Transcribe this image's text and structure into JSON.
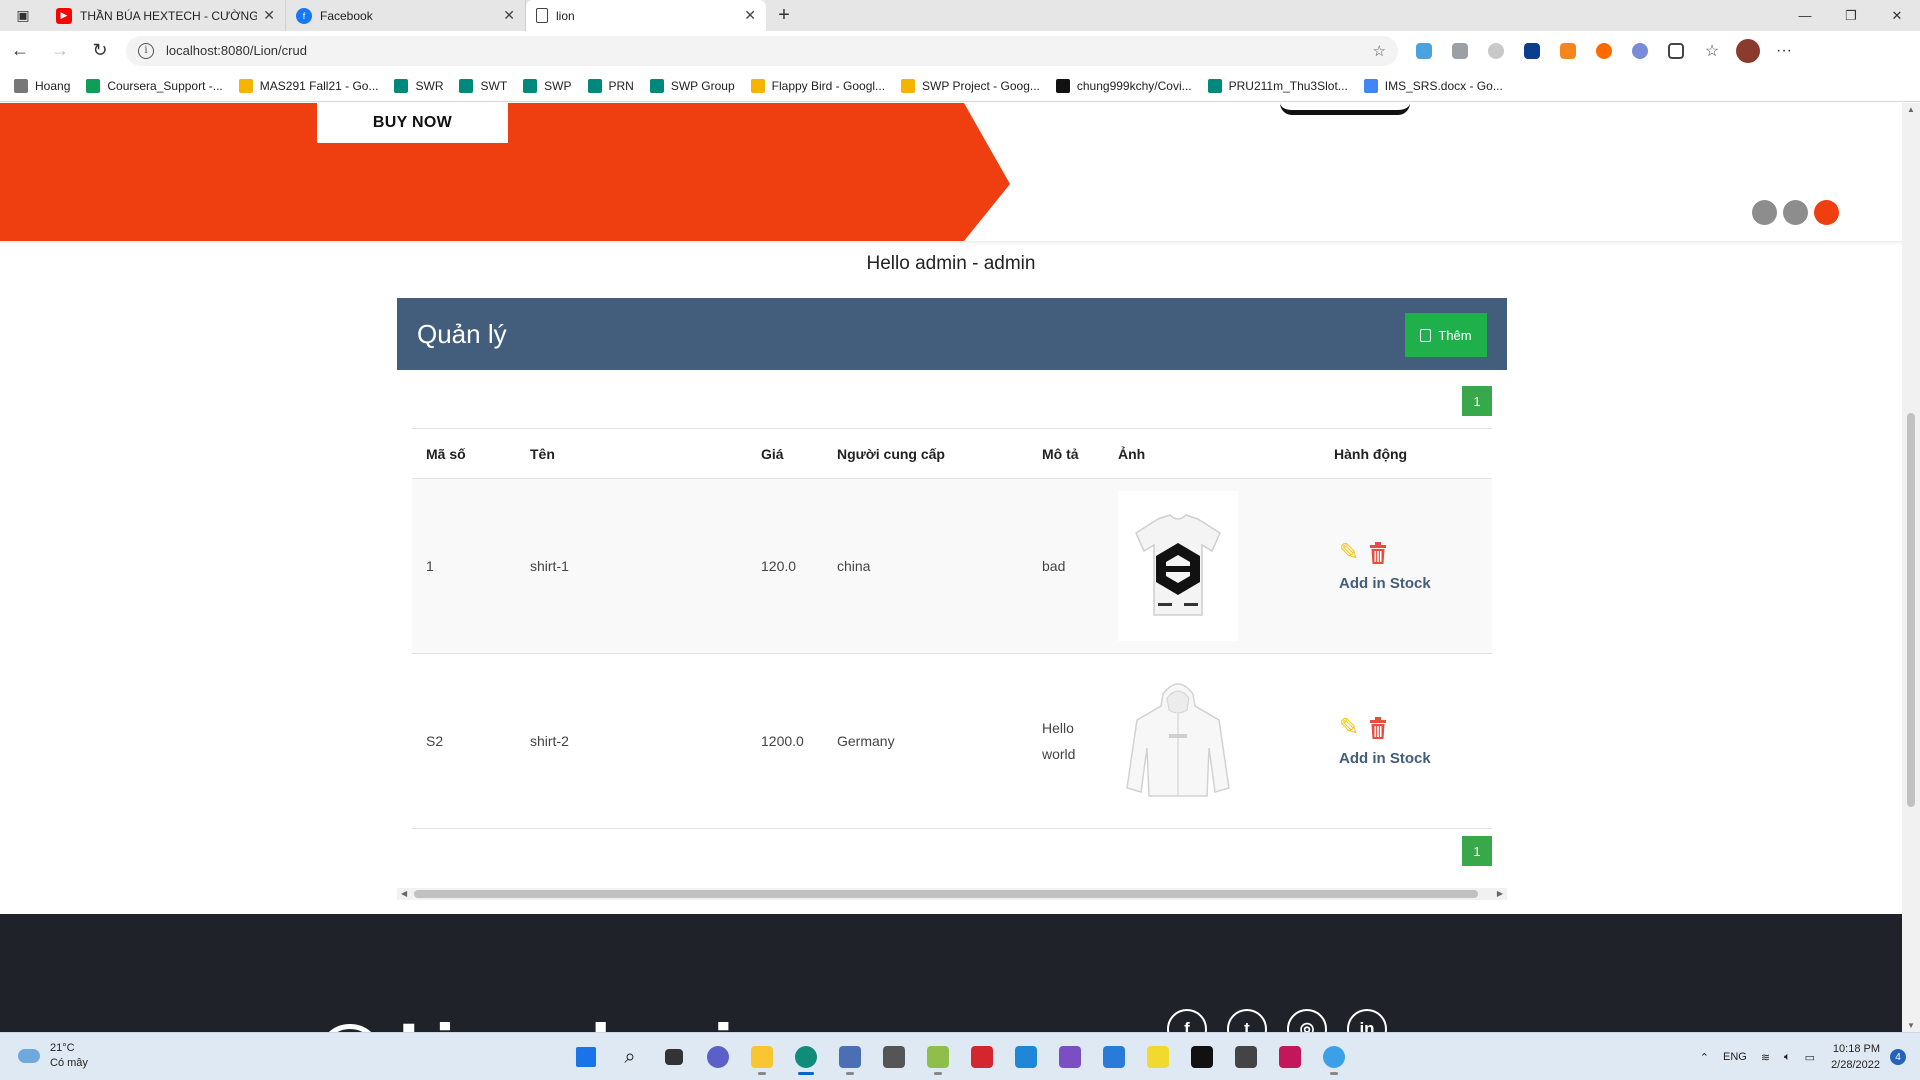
{
  "browser": {
    "tabs": [
      {
        "title": "THẦN BÚA HEXTECH - CƯỜNG",
        "favicon": "youtube-icon",
        "color": "#ff0000"
      },
      {
        "title": "Facebook",
        "favicon": "facebook-icon",
        "color": "#1877f2"
      },
      {
        "title": "lion",
        "favicon": "page-icon",
        "color": "#ffffff"
      }
    ],
    "url": "localhost:8080/Lion/crud",
    "bookmarks": [
      {
        "label": "Hoang",
        "color": "#777777"
      },
      {
        "label": "Coursera_Support -...",
        "color": "#0f9d58"
      },
      {
        "label": "MAS291 Fall21 - Go...",
        "color": "#f4b400"
      },
      {
        "label": "SWR",
        "color": "#00897b"
      },
      {
        "label": "SWT",
        "color": "#00897b"
      },
      {
        "label": "SWP",
        "color": "#00897b"
      },
      {
        "label": "PRN",
        "color": "#00897b"
      },
      {
        "label": "SWP Group",
        "color": "#00897b"
      },
      {
        "label": "Flappy Bird - Googl...",
        "color": "#f4b400"
      },
      {
        "label": "SWP Project - Goog...",
        "color": "#f4b400"
      },
      {
        "label": "chung999kchy/Covi...",
        "color": "#111111"
      },
      {
        "label": "PRU211m_Thu3Slot...",
        "color": "#00897b"
      },
      {
        "label": "IMS_SRS.docx - Go...",
        "color": "#4285f4"
      }
    ]
  },
  "hero": {
    "buy_label": "BUY NOW"
  },
  "greeting": "Hello admin - admin",
  "manage": {
    "title": "Quản lý",
    "add_label": "Thêm",
    "page": "1",
    "columns": [
      "Mã số",
      "Tên",
      "Giá",
      "Người cung cấp",
      "Mô tả",
      "Ảnh",
      "Hành động"
    ],
    "rows": [
      {
        "id": "1",
        "name": "shirt-1",
        "price": "120.0",
        "supplier": "china",
        "desc": "bad",
        "image": "tshirt-image",
        "stock_label": "Add in Stock"
      },
      {
        "id": "S2",
        "name": "shirt-2",
        "price": "1200.0",
        "supplier": "Germany",
        "desc": "Hello world",
        "image": "jacket-image",
        "stock_label": "Add in Stock"
      }
    ]
  },
  "footer": {
    "logo_text": "Lion shoping"
  },
  "taskbar": {
    "temperature": "21°C",
    "weather": "Có mây",
    "lang": "ENG",
    "time": "10:18 PM",
    "date": "2/28/2022",
    "notifications": "4"
  }
}
